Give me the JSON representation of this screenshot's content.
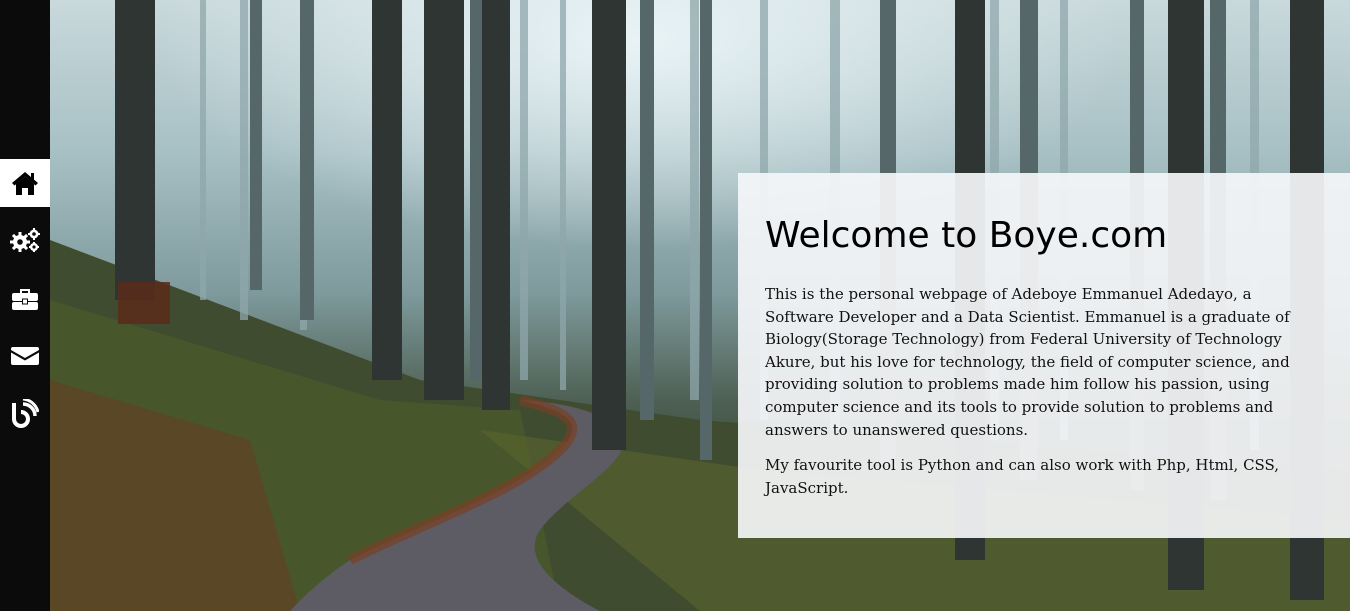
{
  "page": {
    "background_description_icon": "misty-forest-background"
  },
  "sidebar": {
    "items": [
      {
        "name": "home",
        "icon": "home-icon",
        "active": true
      },
      {
        "name": "services",
        "icon": "gears-icon",
        "active": false
      },
      {
        "name": "portfolio",
        "icon": "briefcase-icon",
        "active": false
      },
      {
        "name": "contact",
        "icon": "envelope-icon",
        "active": false
      },
      {
        "name": "blog",
        "icon": "blog-icon",
        "active": false
      }
    ],
    "active_color": "#ffffff",
    "icon_color": "#ffffff",
    "active_icon_color": "#000000",
    "background_color": "#0b0b0b"
  },
  "about": {
    "title": "Welcome to Boye.com",
    "paragraph_1": "This is the personal webpage of Adeboye Emmanuel Adedayo, a Software Developer and a Data Scientist. Emmanuel is a graduate of Biology(Storage Technology) from Federal University of Technology Akure, but his love for technology, the field of computer science, and providing solution to problems made him follow his passion, using computer science and its tools to provide solution to problems and answers to unanswered questions.",
    "paragraph_2": "My favourite tool is Python and can also work with Php, Html, CSS, JavaScript."
  }
}
